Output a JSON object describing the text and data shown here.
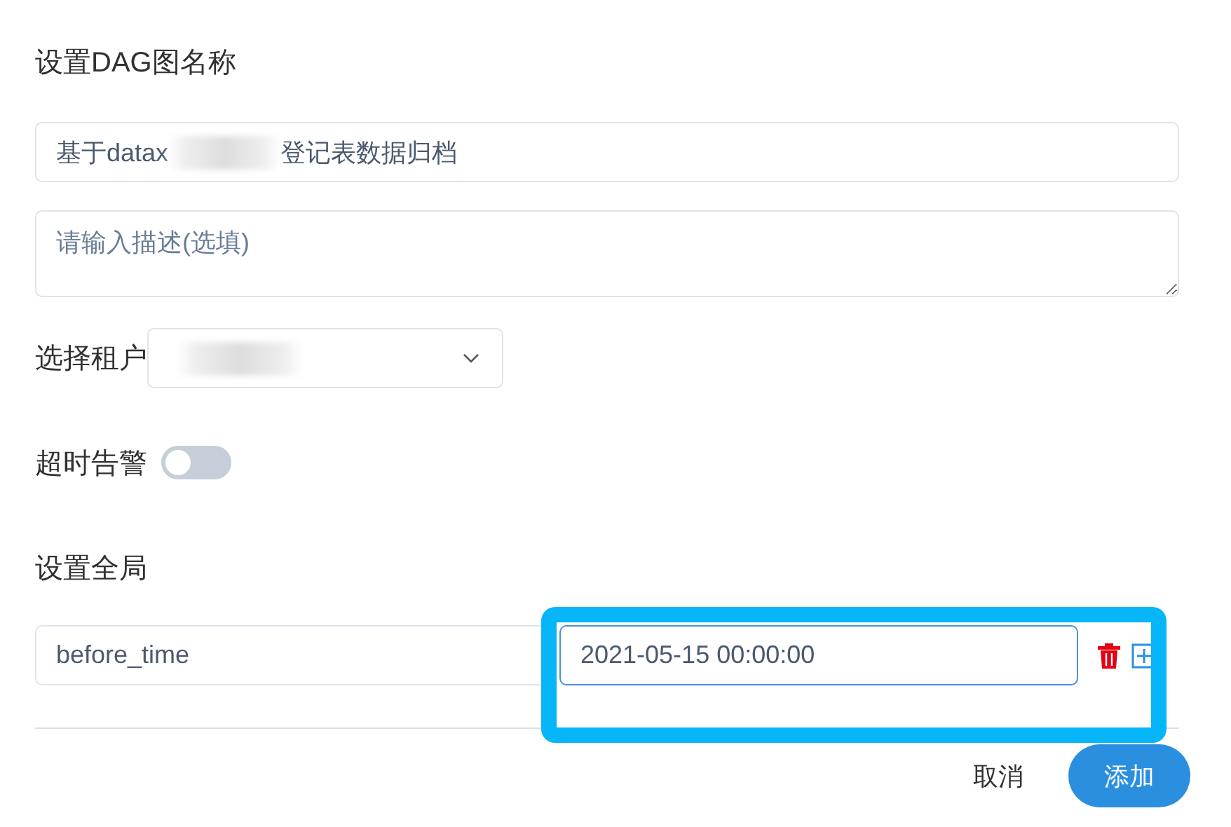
{
  "dialog": {
    "title": "设置DAG图名称",
    "name_field": {
      "value_parts": [
        "基于datax",
        "登记表数据归档"
      ],
      "redacted": true
    },
    "description_field": {
      "placeholder": "请输入描述(选填)"
    },
    "tenant": {
      "label": "选择租户",
      "redacted": true
    },
    "timeout_alarm": {
      "label": "超时告警",
      "on": false
    },
    "globals": {
      "label": "设置全局",
      "params": [
        {
          "key": "before_time",
          "value": "2021-05-15 00:00:00"
        }
      ]
    },
    "highlight": true,
    "buttons": [
      {
        "label": "取消",
        "kind": "text"
      },
      {
        "label": "添加",
        "kind": "primary"
      }
    ]
  }
}
